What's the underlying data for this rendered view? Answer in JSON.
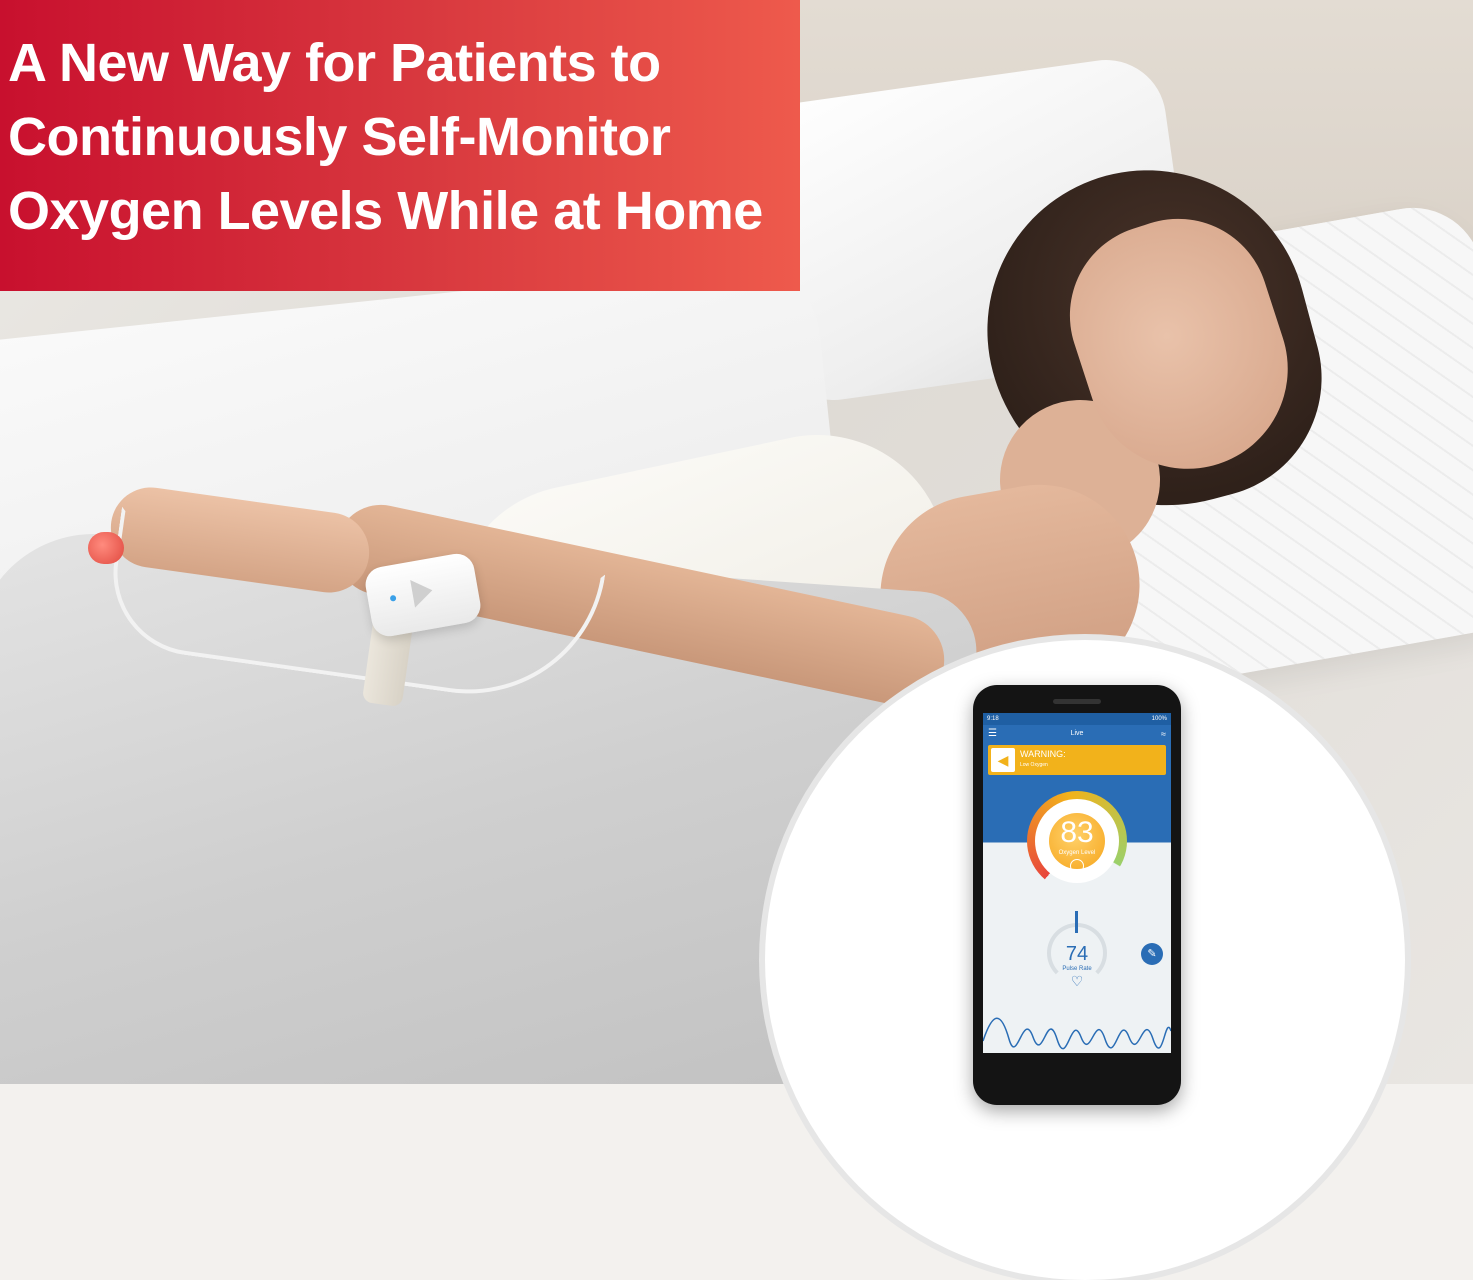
{
  "headline": {
    "lines": [
      "A New Way for Patients to",
      "Continuously Self-Monitor",
      "Oxygen Levels While at Home"
    ]
  },
  "colors": {
    "banner_start": "#c8102e",
    "banner_end": "#ee5a4c",
    "app_blue": "#2a6db5",
    "warning_yellow": "#f2b21b",
    "oxygen_orange": "#f6a51c"
  },
  "phone_app": {
    "status_time": "9:18",
    "status_battery": "100%",
    "title": "Live",
    "menu_icon": "hamburger-menu-icon",
    "trend_icon": "trend-chart-icon",
    "warning": {
      "icon": "speaker-icon",
      "title": "WARNING:",
      "subtitle": "Low Oxygen"
    },
    "oxygen": {
      "value": "83",
      "label": "Oxygen Level"
    },
    "pulse": {
      "value": "74",
      "label": "Pulse Rate",
      "icon": "heart-icon"
    },
    "notes_icon": "notes-icon"
  }
}
